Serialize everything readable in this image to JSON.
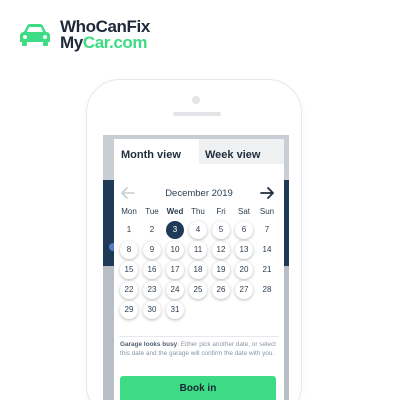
{
  "logo": {
    "line1": "WhoCanFix",
    "line2_part1": "My",
    "line2_part2": "Car.com",
    "icon": "car-icon",
    "colors": {
      "brand_green": "#3ddc84",
      "brand_dark": "#1e2a3a"
    }
  },
  "modal": {
    "tabs": [
      {
        "label": "Month view",
        "active": true
      },
      {
        "label": "Week view",
        "active": false
      }
    ],
    "month_label": "December 2019",
    "prev_icon": "arrow-left-icon",
    "next_icon": "arrow-right-icon",
    "weekdays": [
      "Mon",
      "Tue",
      "Wed",
      "Thu",
      "Fri",
      "Sat",
      "Sun"
    ],
    "highlight_weekday": "Wed",
    "weeks": [
      [
        {
          "d": "1",
          "s": "plain"
        },
        {
          "d": "2",
          "s": "plain"
        },
        {
          "d": "3",
          "s": "today"
        },
        {
          "d": "4",
          "s": "avail"
        },
        {
          "d": "5",
          "s": "avail"
        },
        {
          "d": "6",
          "s": "avail"
        },
        {
          "d": "7",
          "s": "plain"
        }
      ],
      [
        {
          "d": "8",
          "s": "avail"
        },
        {
          "d": "9",
          "s": "avail"
        },
        {
          "d": "10",
          "s": "avail"
        },
        {
          "d": "11",
          "s": "avail"
        },
        {
          "d": "12",
          "s": "avail"
        },
        {
          "d": "13",
          "s": "avail"
        },
        {
          "d": "14",
          "s": "plain"
        }
      ],
      [
        {
          "d": "15",
          "s": "avail"
        },
        {
          "d": "16",
          "s": "avail"
        },
        {
          "d": "17",
          "s": "avail"
        },
        {
          "d": "18",
          "s": "avail"
        },
        {
          "d": "19",
          "s": "avail"
        },
        {
          "d": "20",
          "s": "avail"
        },
        {
          "d": "21",
          "s": "plain"
        }
      ],
      [
        {
          "d": "22",
          "s": "avail"
        },
        {
          "d": "23",
          "s": "avail"
        },
        {
          "d": "24",
          "s": "avail"
        },
        {
          "d": "25",
          "s": "avail"
        },
        {
          "d": "26",
          "s": "avail"
        },
        {
          "d": "27",
          "s": "avail"
        },
        {
          "d": "28",
          "s": "plain"
        }
      ],
      [
        {
          "d": "29",
          "s": "avail"
        },
        {
          "d": "30",
          "s": "avail"
        },
        {
          "d": "31",
          "s": "avail"
        }
      ]
    ],
    "notice_bold": "Garage looks busy",
    "notice_rest": ". Either pick another date, or select this date and the garage will confirm the date with you.",
    "book_label": "Book in",
    "colors": {
      "today": "#1f3a57",
      "book": "#3ddc84"
    }
  }
}
